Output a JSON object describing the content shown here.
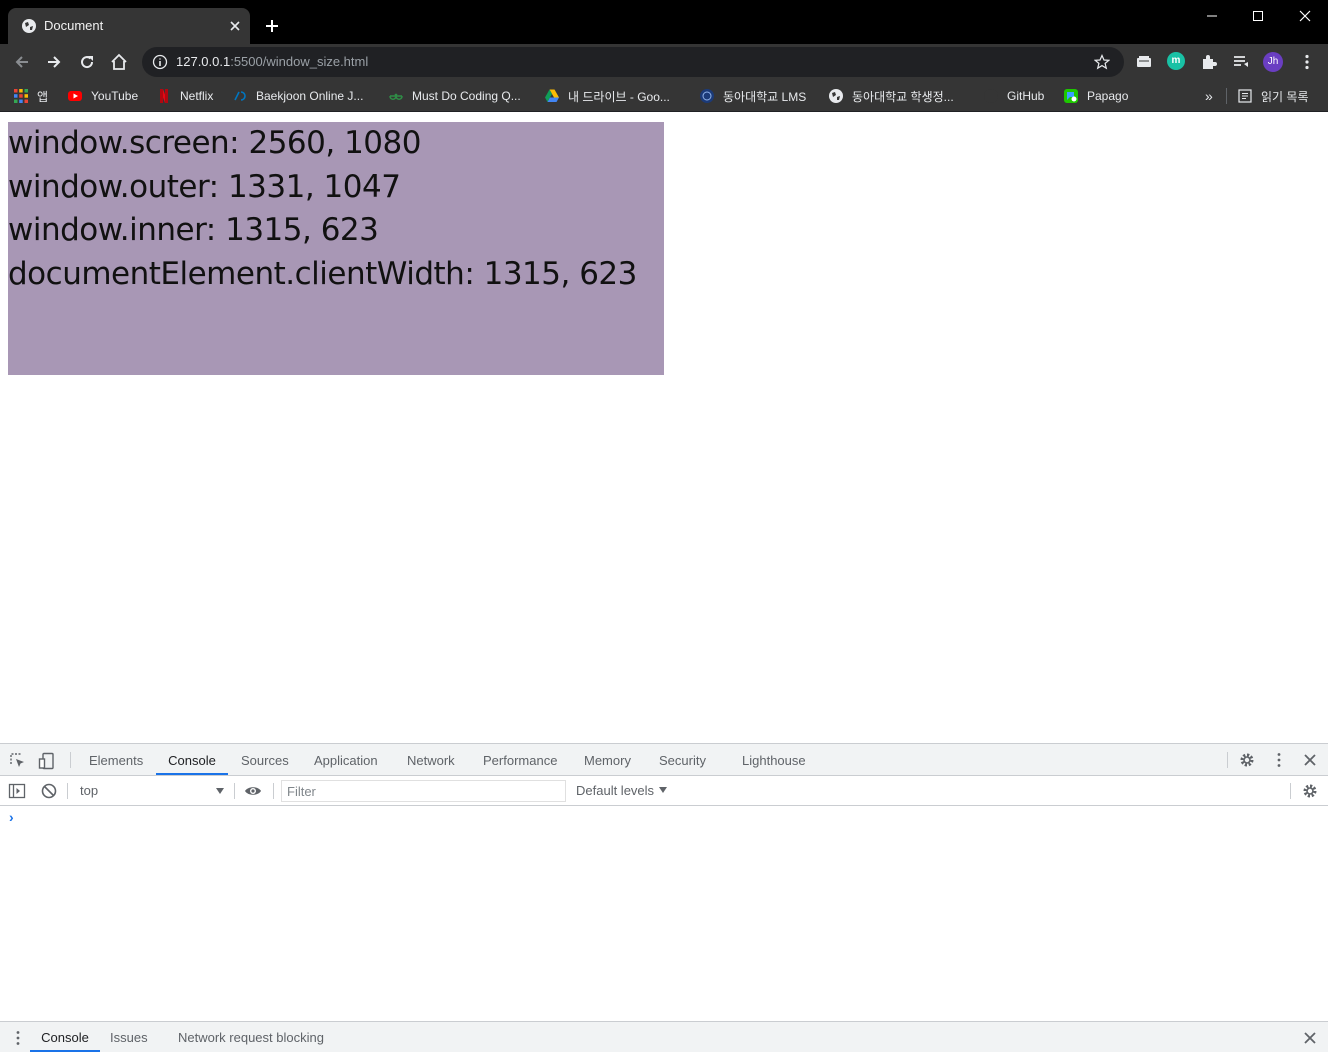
{
  "browser": {
    "tab_title": "Document",
    "url_host": "127.0.0.1",
    "url_rest": ":5500/window_size.html",
    "avatar_initials": "Jh",
    "extension_letter": "m"
  },
  "bookmarks": [
    {
      "label": "앱",
      "icon": "apps-grid-icon"
    },
    {
      "label": "YouTube",
      "icon": "youtube-icon"
    },
    {
      "label": "Netflix",
      "icon": "netflix-icon"
    },
    {
      "label": "Baekjoon Online J...",
      "icon": "baekjoon-icon"
    },
    {
      "label": "Must Do Coding Q...",
      "icon": "geeksforgeeks-icon"
    },
    {
      "label": "내 드라이브 - Goo...",
      "icon": "google-drive-icon"
    },
    {
      "label": "동아대학교 LMS",
      "icon": "lms-icon"
    },
    {
      "label": "동아대학교 학생정...",
      "icon": "globe-icon"
    },
    {
      "label": "GitHub",
      "icon": "github-icon"
    },
    {
      "label": "Papago",
      "icon": "papago-icon"
    }
  ],
  "bookmarks_overflow": "»",
  "reading_list": "읽기 목록",
  "page": {
    "lines": [
      "window.screen: 2560, 1080",
      "window.outer: 1331, 1047",
      "window.inner: 1315, 623",
      "documentElement.clientWidth: 1315, 623"
    ]
  },
  "devtools": {
    "tabs": [
      "Elements",
      "Console",
      "Sources",
      "Application",
      "Network",
      "Performance",
      "Memory",
      "Security",
      "Lighthouse"
    ],
    "active_tab": "Console",
    "context": "top",
    "filter_placeholder": "Filter",
    "levels_label": "Default levels",
    "prompt": "›",
    "drawer_tabs": [
      "Console",
      "Issues",
      "Network request blocking"
    ]
  },
  "colors": {
    "info_box": "#a897b5",
    "accent": "#1a73e8"
  }
}
